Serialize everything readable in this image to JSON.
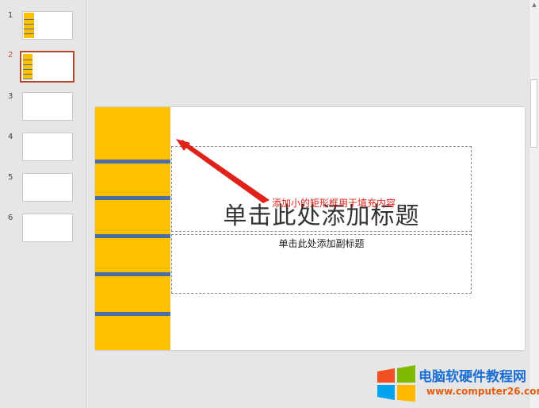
{
  "thumbnails": [
    {
      "number": "1",
      "active": false,
      "has_bar": true
    },
    {
      "number": "2",
      "active": true,
      "has_bar": true
    },
    {
      "number": "3",
      "active": false,
      "has_bar": false
    },
    {
      "number": "4",
      "active": false,
      "has_bar": false
    },
    {
      "number": "5",
      "active": false,
      "has_bar": false
    },
    {
      "number": "6",
      "active": false,
      "has_bar": false
    }
  ],
  "slide": {
    "title_placeholder": "单击此处添加标题",
    "subtitle_placeholder": "单击此处添加副标题",
    "bar_color": "#ffc000",
    "stripe_color": "#4a6fa0"
  },
  "annotation": {
    "text": "添加小的矩形框用于填充内容",
    "color": "#e0221b"
  },
  "watermark": {
    "site_name": "电脑软硬件教程网",
    "url": "www.computer26.com",
    "logo": "windows-logo-icon"
  }
}
